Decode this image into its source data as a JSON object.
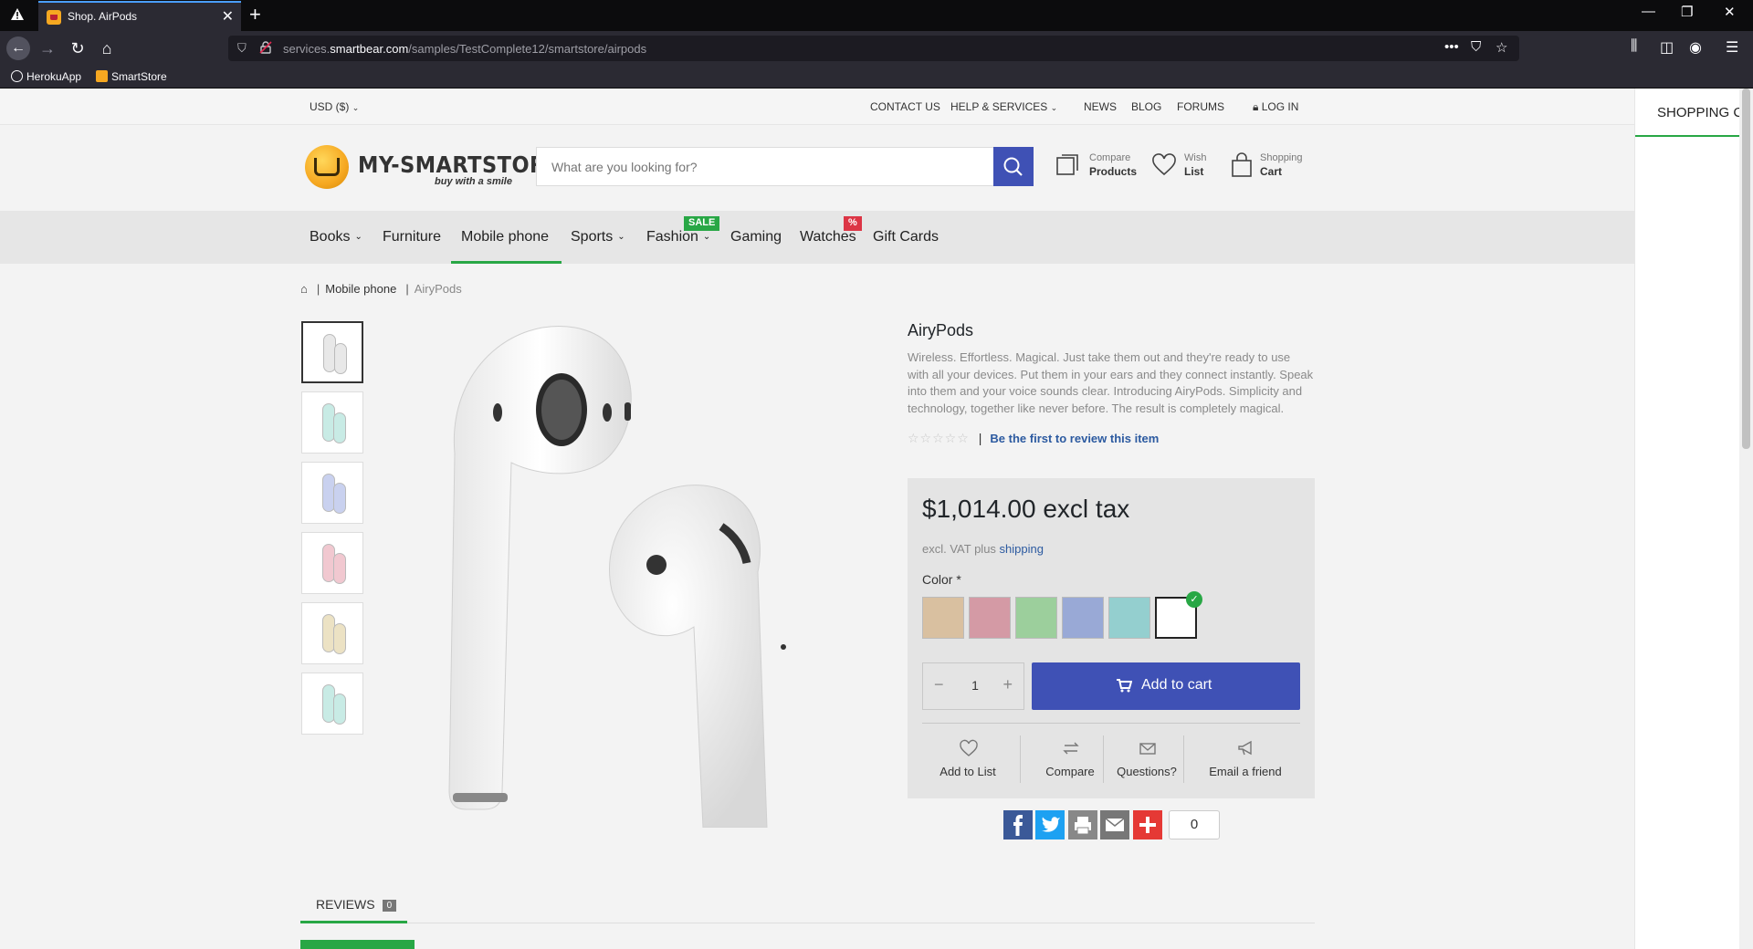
{
  "browser": {
    "tab_title": "Shop. AirPods",
    "url_prefix": "services.",
    "url_domain": "smartbear.com",
    "url_path": "/samples/TestComplete12/smartstore/airpods",
    "bookmarks": [
      "HerokuApp",
      "SmartStore"
    ]
  },
  "topbar": {
    "currency": "USD  ($)",
    "links": [
      "CONTACT US",
      "HELP & SERVICES",
      "NEWS",
      "BLOG",
      "FORUMS",
      "LOG IN"
    ]
  },
  "header": {
    "logo_name": "MY-SMARTSTORE",
    "logo_tagline": "buy with a smile",
    "search_placeholder": "What are you looking for?",
    "compare_l1": "Compare",
    "compare_l2": "Products",
    "wish_l1": "Wish",
    "wish_l2": "List",
    "cart_l1": "Shopping",
    "cart_l2": "Cart"
  },
  "nav": {
    "items": [
      "Books",
      "Furniture",
      "Mobile phone",
      "Sports",
      "Fashion",
      "Gaming",
      "Watches",
      "Gift Cards"
    ],
    "sale_badge": "SALE",
    "pct_badge": "%"
  },
  "breadcrumb": {
    "category": "Mobile phone",
    "current": "AiryPods"
  },
  "product": {
    "title": "AiryPods",
    "description": "Wireless. Effortless. Magical. Just take them out and they're ready to use with all your devices. Put them in your ears and they connect instantly. Speak into them and your voice sounds clear. Introducing AiryPods. Simplicity and technology, together like never before. The result is completely magical.",
    "stars": "☆☆☆☆☆",
    "review_link": "Be the first to review this item",
    "price": "$1,014.00 excl tax",
    "vat_text": "excl. VAT plus",
    "vat_link": "shipping",
    "color_label": "Color *",
    "swatch_colors": [
      "#d9c0a0",
      "#d49aa5",
      "#9ccf9c",
      "#99a9d6",
      "#94cfcf",
      "#ffffff"
    ],
    "quantity": "1",
    "add_to_cart": "Add to cart",
    "actions": [
      "Add to List",
      "Compare",
      "Questions?",
      "Email a friend"
    ],
    "share_count": "0",
    "thumb_colors": [
      "#e8e8e8",
      "#c8ebe5",
      "#c9d1ef",
      "#f1c8d0",
      "#ece2c4",
      "#c8ebe5"
    ]
  },
  "tabs": {
    "reviews_label": "REVIEWS",
    "reviews_count": "0"
  },
  "flyout": {
    "title": "SHOPPING CA"
  }
}
